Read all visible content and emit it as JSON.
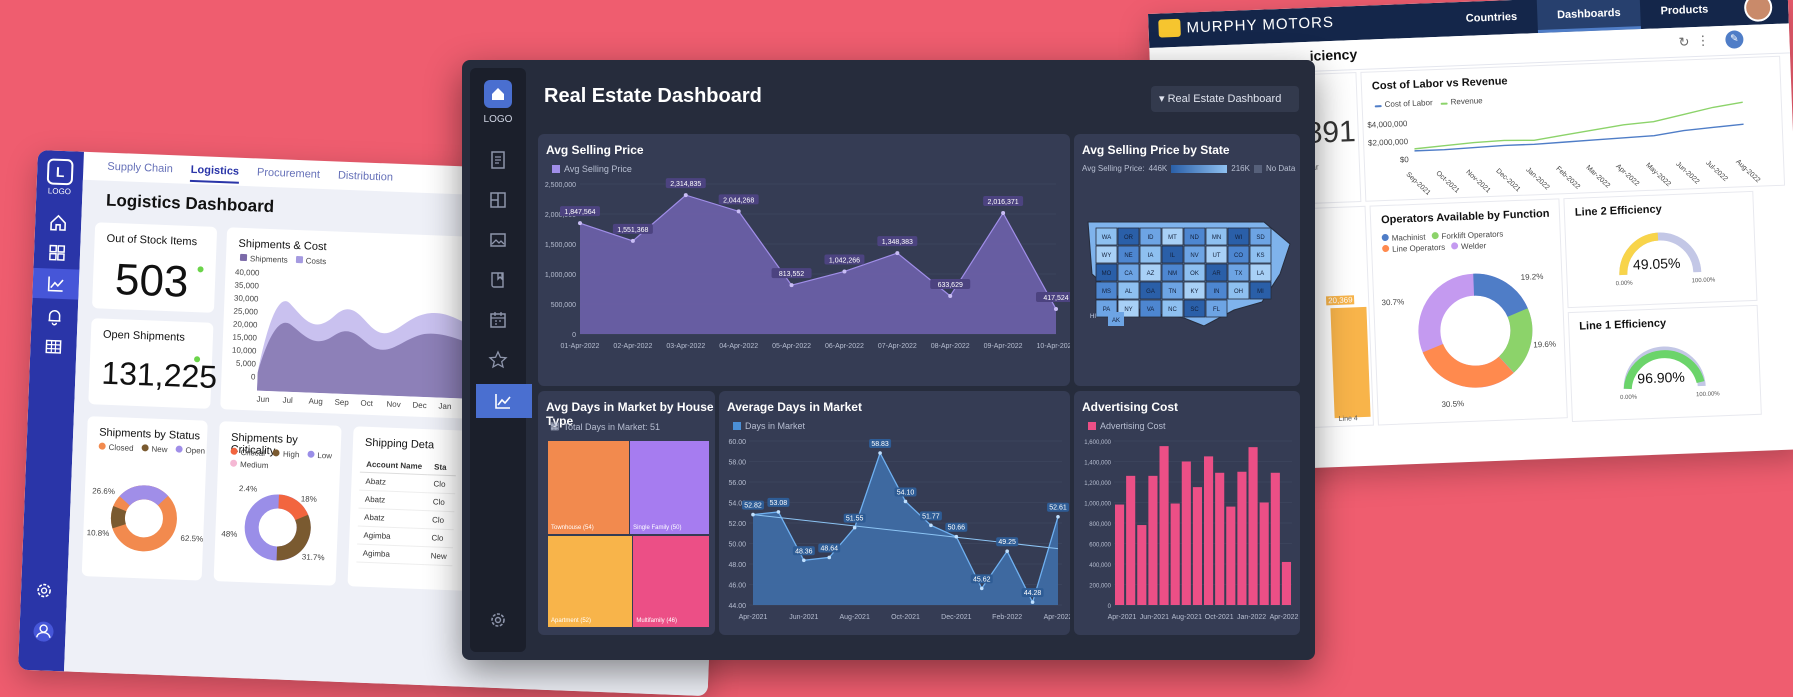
{
  "logistics": {
    "logo_letter": "L",
    "logo_text": "LOGO",
    "tabs": [
      "Supply Chain",
      "Logistics",
      "Procurement",
      "Distribution"
    ],
    "title": "Logistics Dashboard",
    "out_of_stock": {
      "label": "Out of Stock Items",
      "value": "503"
    },
    "open_shipments": {
      "label": "Open Shipments",
      "value": "131,225"
    },
    "ship_cost": {
      "title": "Shipments & Cost",
      "legend": [
        "Shipments",
        "Costs"
      ],
      "yticks": [
        "40,000",
        "35,000",
        "30,000",
        "25,000",
        "20,000",
        "15,000",
        "10,000",
        "5,000",
        "0"
      ],
      "xticks": [
        "Jun",
        "Jul",
        "Aug",
        "Sep",
        "Oct",
        "Nov",
        "Dec",
        "Jan",
        "F"
      ]
    },
    "by_status": {
      "title": "Shipments by Status",
      "legend": [
        "Closed",
        "New",
        "Open"
      ],
      "labels": [
        "26.6%",
        "10.8%",
        "62.5%"
      ]
    },
    "by_criticality": {
      "title": "Shipments by Criticality",
      "legend": [
        "Critical",
        "High",
        "Low",
        "Medium"
      ],
      "labels": [
        "2.4%",
        "18%",
        "48%",
        "31.7%"
      ]
    },
    "shipping_details": {
      "title": "Shipping Deta",
      "headers": [
        "Account Name",
        "Sta"
      ],
      "rows": [
        [
          "Abatz",
          "Clo"
        ],
        [
          "Abatz",
          "Clo"
        ],
        [
          "Abatz",
          "Clo"
        ],
        [
          "Agimba",
          "Clo"
        ],
        [
          "Agimba",
          "New"
        ]
      ]
    }
  },
  "murphy": {
    "brand": "MURPHY MOTORS",
    "nav": [
      "Countries",
      "Dashboards",
      "Products"
    ],
    "page_title": "iciency",
    "kpi_partial": "891",
    "kpi_sub": "ear",
    "bar_label": "20,369",
    "bar_x": "Line 4",
    "labor_rev": {
      "title": "Cost of Labor vs Revenue",
      "legend": [
        "Cost of Labor",
        "Revenue"
      ],
      "yticks": [
        "$4,000,000",
        "$2,000,000",
        "$0"
      ],
      "xticks": [
        "Sep-2021",
        "Oct-2021",
        "Nov-2021",
        "Dec-2021",
        "Jan-2022",
        "Feb-2022",
        "Mar-2022",
        "Apr-2022",
        "May-2022",
        "Jun-2022",
        "Jul-2022",
        "Aug-2022"
      ]
    },
    "operators": {
      "title": "Operators Available by Function",
      "legend": [
        "Machinist",
        "Forklift Operators",
        "Line Operators",
        "Welder"
      ],
      "labels": [
        "19.2%",
        "19.6%",
        "30.5%",
        "30.7%"
      ]
    },
    "line2": {
      "title": "Line 2 Efficiency",
      "value": "49.05%",
      "min": "0.00%",
      "max": "100.00%"
    },
    "line1": {
      "title": "Line 1 Efficiency",
      "value": "96.90%",
      "min": "0.00%",
      "max": "100.00%"
    }
  },
  "realestate": {
    "logo_text": "LOGO",
    "title": "Real Estate Dashboard",
    "dropdown": "Real Estate Dashboard",
    "avg_price": {
      "title": "Avg Selling Price",
      "legend": "Avg Selling Price"
    },
    "by_state": {
      "title": "Avg Selling Price by State",
      "scale_prefix": "Avg Selling Price:",
      "scale_max": "446K",
      "scale_min": "216K",
      "no_data": "No Data",
      "states": [
        "WA",
        "OR",
        "ID",
        "MT",
        "ND",
        "MN",
        "WI",
        "SD",
        "WY",
        "NE",
        "IA",
        "IL",
        "NV",
        "UT",
        "CO",
        "KS",
        "MO",
        "CA",
        "AZ",
        "NM",
        "OK",
        "AR",
        "TX",
        "LA",
        "MS",
        "AL",
        "GA",
        "TN",
        "KY",
        "IN",
        "OH",
        "MI",
        "PA",
        "NY",
        "VA",
        "NC",
        "SC",
        "FL",
        "HI",
        "AK"
      ]
    },
    "days_type": {
      "title": "Avg Days in Market by House Type",
      "total": "Total Days in Market: 51"
    },
    "days_market": {
      "title": "Average Days in Market",
      "legend": "Days in Market"
    },
    "adv_cost": {
      "title": "Advertising Cost",
      "legend": "Advertising Cost"
    }
  },
  "chart_data": [
    {
      "type": "area",
      "title": "Avg Selling Price",
      "x": [
        "01-Apr-2022",
        "02-Apr-2022",
        "03-Apr-2022",
        "04-Apr-2022",
        "05-Apr-2022",
        "06-Apr-2022",
        "07-Apr-2022",
        "08-Apr-2022",
        "09-Apr-2022",
        "10-Apr-2022"
      ],
      "series": [
        {
          "name": "Avg Selling Price",
          "values": [
            1847564,
            1551368,
            2314835,
            2044268,
            813552,
            1042266,
            1348383,
            633629,
            2016371,
            417524
          ]
        }
      ],
      "labels": [
        "1,847,564",
        "1,551,368",
        "2,314,835",
        "2,044,268",
        "813,552",
        "1,042,266",
        "1,348,383",
        "633,629",
        "2,016,371",
        "417,524"
      ],
      "yticks": [
        "2,500,000",
        "2,000,000",
        "1,500,000",
        "1,000,000",
        "500,000",
        "0"
      ],
      "ylim": [
        0,
        2500000
      ]
    },
    {
      "type": "heatmap",
      "title": "Avg Days in Market by House Type",
      "categories": [
        "Townhouse",
        "Single Family",
        "Apartment",
        "Multifamily"
      ],
      "values": [
        54,
        50,
        52,
        46
      ],
      "labels": [
        "Townhouse (54)",
        "Single Family (50)",
        "Apartment (52)",
        "Multifamily (46)"
      ],
      "colors": [
        "#f28a4e",
        "#a67cf0",
        "#f8b44a",
        "#ec4f86"
      ]
    },
    {
      "type": "line",
      "title": "Average Days in Market",
      "xticks": [
        "Apr-2021",
        "Jun-2021",
        "Aug-2021",
        "Oct-2021",
        "Dec-2021",
        "Feb-2022",
        "Apr-2022"
      ],
      "series": [
        {
          "name": "Days in Market",
          "values": [
            52.82,
            53.08,
            48.36,
            48.64,
            51.55,
            58.83,
            54.1,
            51.77,
            50.66,
            45.62,
            49.25,
            44.28,
            52.61
          ]
        }
      ],
      "labels": [
        "52.82",
        "53.08",
        "48.36",
        "48.64",
        "51.55",
        "58.83",
        "54.10",
        "51.77",
        "50.66",
        "45.62",
        "49.25",
        "44.28",
        "52.61"
      ],
      "yticks": [
        "60.00",
        "58.00",
        "56.00",
        "54.00",
        "52.00",
        "50.00",
        "48.00",
        "46.00",
        "44.00"
      ],
      "ylim": [
        44,
        60
      ]
    },
    {
      "type": "bar",
      "title": "Advertising Cost",
      "xticks": [
        "Apr-2021",
        "Jun-2021",
        "Aug-2021",
        "Oct-2021",
        "Jan-2022",
        "Apr-2022"
      ],
      "series": [
        {
          "name": "Advertising Cost",
          "values": [
            980000,
            1260000,
            780000,
            1260000,
            1550000,
            990000,
            1400000,
            1150000,
            1450000,
            1290000,
            960000,
            1300000,
            1540000,
            1000000,
            1290000,
            420000
          ]
        }
      ],
      "yticks": [
        "1,600,000",
        "1,400,000",
        "1,200,000",
        "1,000,000",
        "800,000",
        "600,000",
        "400,000",
        "200,000",
        "0"
      ],
      "ylim": [
        0,
        1600000
      ]
    }
  ],
  "colors": {
    "realestate_bg": "#262c3c",
    "accent": "#4a6fd0",
    "area": "#7a6bb5",
    "days": "#4b8fd6",
    "adv": "#ec4f86",
    "page": "#ef5d6f"
  }
}
